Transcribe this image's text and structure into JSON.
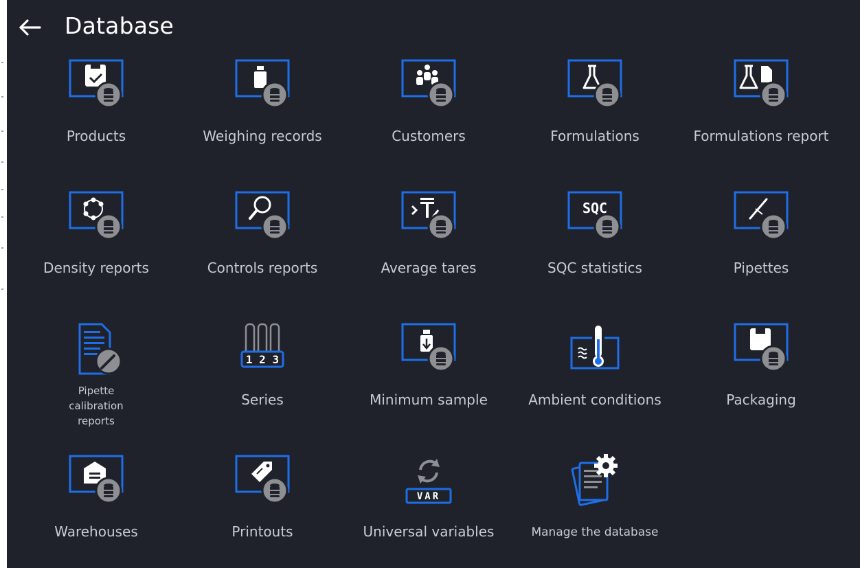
{
  "header": {
    "title": "Database"
  },
  "tiles": [
    {
      "label": "Products",
      "icon": "products-db-icon"
    },
    {
      "label": "Weighing records",
      "icon": "weighing-records-db-icon"
    },
    {
      "label": "Customers",
      "icon": "customers-db-icon"
    },
    {
      "label": "Formulations",
      "icon": "formulations-db-icon"
    },
    {
      "label": "Formulations report",
      "icon": "formulations-report-db-icon"
    },
    {
      "label": "Density reports",
      "icon": "density-reports-db-icon"
    },
    {
      "label": "Controls reports",
      "icon": "controls-reports-db-icon"
    },
    {
      "label": "Average tares",
      "icon": "average-tares-db-icon"
    },
    {
      "label": "SQC statistics",
      "icon": "sqc-statistics-db-icon",
      "icon_text": "SQC"
    },
    {
      "label": "Pipettes",
      "icon": "pipettes-db-icon"
    },
    {
      "label": "Pipette calibration reports",
      "icon": "pipette-calibration-reports-icon"
    },
    {
      "label": "Series",
      "icon": "series-icon",
      "icon_text": "1 2 3"
    },
    {
      "label": "Minimum sample",
      "icon": "minimum-sample-db-icon"
    },
    {
      "label": "Ambient conditions",
      "icon": "ambient-conditions-icon"
    },
    {
      "label": "Packaging",
      "icon": "packaging-db-icon"
    },
    {
      "label": "Warehouses",
      "icon": "warehouses-db-icon"
    },
    {
      "label": "Printouts",
      "icon": "printouts-db-icon"
    },
    {
      "label": "Universal variables",
      "icon": "universal-variables-icon",
      "icon_text": "VAR"
    },
    {
      "label": "Manage the database",
      "icon": "manage-database-icon"
    }
  ],
  "colors": {
    "background": "#1f222a",
    "accent": "#1e6ee8",
    "badge": "#8d8f93",
    "label": "#c9cbd1"
  }
}
